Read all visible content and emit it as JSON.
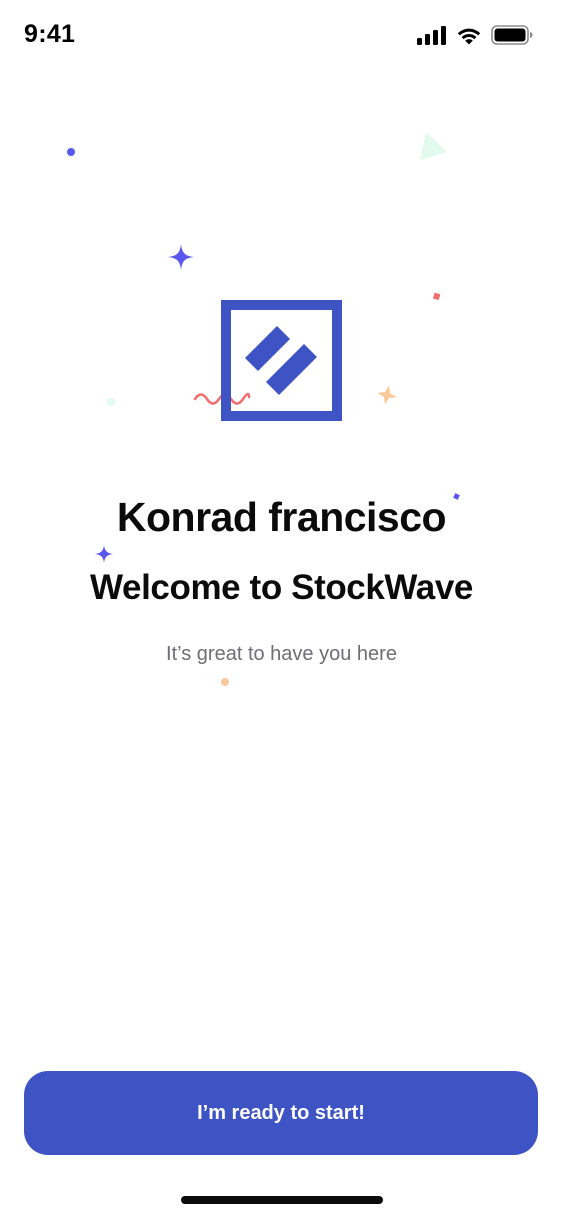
{
  "status_bar": {
    "time": "9:41",
    "icons": [
      "cellular-signal-icon",
      "wifi-icon",
      "battery-icon"
    ]
  },
  "logo": {
    "icon": "stockwave-logo-icon",
    "color": "#3e54c4"
  },
  "welcome": {
    "name": "Konrad francisco",
    "title": "Welcome to StockWave",
    "subtitle": "It’s great to have you here"
  },
  "cta": {
    "label": "I’m ready to start!",
    "color": "#3e54c4"
  },
  "colors": {
    "accent": "#3e54c4",
    "confetti_purple": "#5a57f0",
    "confetti_red": "#f26d6d",
    "confetti_orange": "#f8c99a",
    "confetti_mint": "#e3faf1"
  }
}
